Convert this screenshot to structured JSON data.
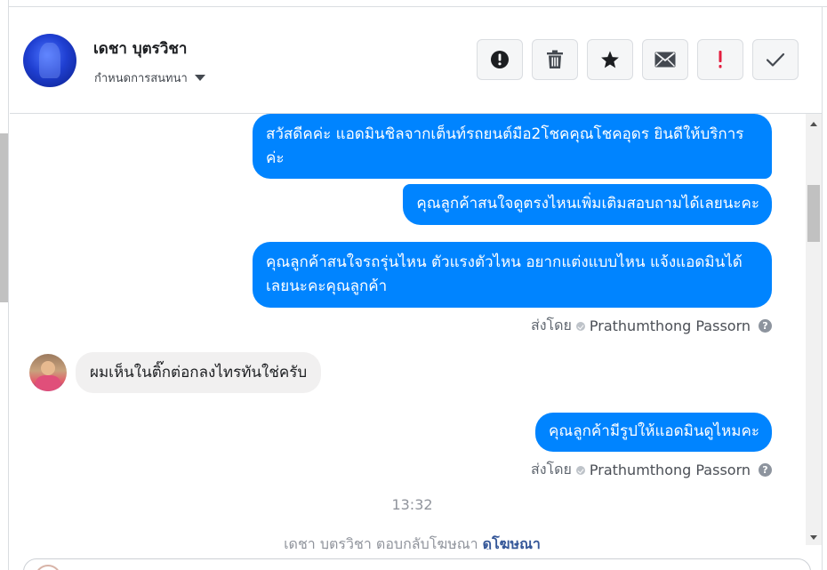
{
  "header": {
    "contact_name": "เดชา บุตรวิชา",
    "conversation_settings": "กำหนดการสนทนา",
    "actions": [
      {
        "icon": "alert-circle-icon",
        "label": "Mark as spam"
      },
      {
        "icon": "trash-icon",
        "label": "Delete"
      },
      {
        "icon": "star-icon",
        "label": "Star"
      },
      {
        "icon": "envelope-icon",
        "label": "Mark as unread"
      },
      {
        "icon": "exclamation-icon",
        "label": "Follow up"
      },
      {
        "icon": "check-icon",
        "label": "Done"
      }
    ]
  },
  "messages": {
    "out_1": "สวัสดีคค่ะ แอดมินชิลจากเต็นท์รถยนต์มือ2โชคคุณโชคอุดร ยินดีให้บริการค่ะ",
    "out_2": "คุณลูกค้าสนใจดูตรงไหนเพิ่มเติมสอบถามได้เลยนะคะ",
    "out_3": "คุณลูกค้าสนใจรถรุ่นไหน ตัวแรงตัวไหน อยากแต่งแบบไหน แจ้งแอดมินได้เลยนะคะคุณลูกค้า",
    "in_1": "ผมเห็นในติ๊กต่อกลงไทรทันใช่ครับ",
    "out_4": "คุณลูกค้ามีรูปให้แอดมินดูไหมคะ"
  },
  "sent_by": {
    "prefix": "ส่งโดย",
    "name": "Prathumthong Passorn",
    "help": "?"
  },
  "timestamp": "13:32",
  "bottom_note": {
    "text": "เดชา บุตรวิชา ตอบกลับโฆษณา",
    "link": "ดูโฆษณา"
  },
  "colors": {
    "outgoing_bubble": "#0084ff",
    "incoming_bubble": "#f1f0f0",
    "accent_red": "#e41e3f"
  }
}
